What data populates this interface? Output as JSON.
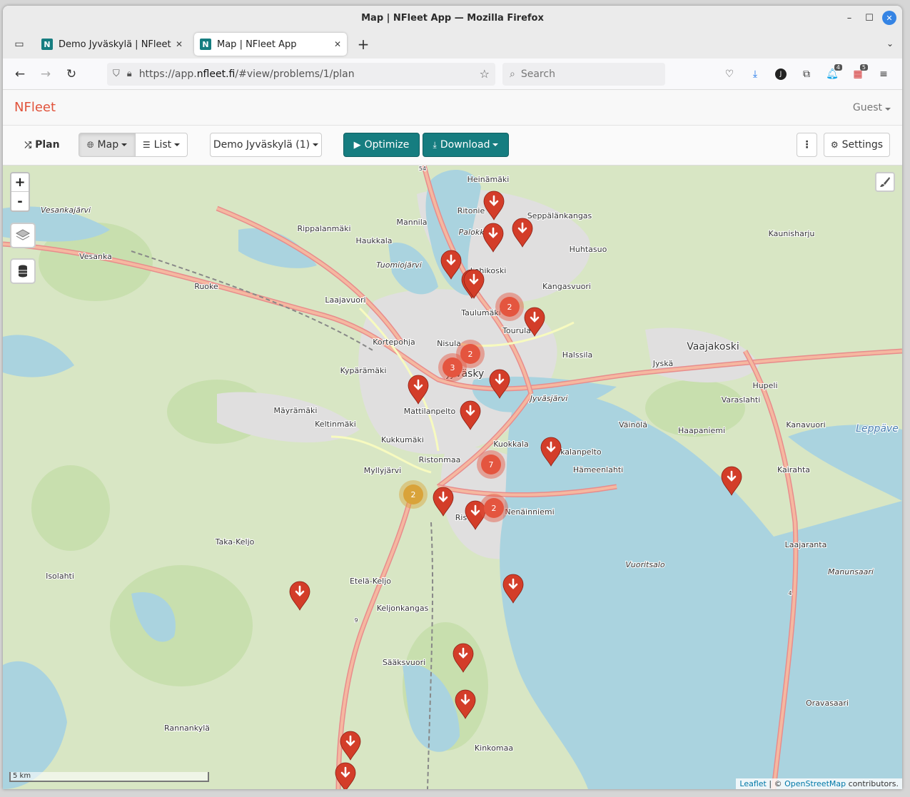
{
  "window": {
    "title": "Map | NFleet App — Mozilla Firefox"
  },
  "tabs": [
    {
      "favicon": "N",
      "label": "Demo Jyväskylä | NFleet Co",
      "close": "✕"
    },
    {
      "favicon": "N",
      "label": "Map | NFleet App",
      "close": "✕"
    }
  ],
  "nav": {
    "url_prefix": "https://app.",
    "url_domain": "nfleet.fi",
    "url_suffix": "/#view/problems/1/plan",
    "search_placeholder": "Search",
    "extension_badges": [
      "4",
      "5"
    ],
    "profile_initial": "J"
  },
  "app": {
    "brand": "NFleet",
    "user_menu": "Guest"
  },
  "toolbar": {
    "plan_label": "Plan",
    "map_label": "Map",
    "list_label": "List",
    "problem_select": "Demo Jyväskylä (1)",
    "optimize_label": "Optimize",
    "download_label": "Download",
    "more_label": "⋮",
    "settings_label": "Settings",
    "accent_color": "#167d80"
  },
  "map": {
    "zoom_in": "+",
    "zoom_out": "-",
    "scale_label": "5 km",
    "attribution_leaflet": "Leaflet",
    "attribution_sep": " | © ",
    "attribution_osm": "OpenStreetMap",
    "attribution_tail": " contributors.",
    "marker_color": "#d33d29",
    "place_labels": [
      "Heinämäki",
      "Ritonie",
      "Seppälänkangas",
      "Mannila",
      "Rippalanmäki",
      "Haukkala",
      "Huhtasuo",
      "Vesanka",
      "Kaunisharju",
      "Lohikoski",
      "Ruoke",
      "Kangasvuori",
      "Laajavuori",
      "Taulumäki",
      "Tourula",
      "Kortepohja",
      "Nisula",
      "Halssila",
      "Jyskä",
      "Vaajakoski",
      "Kypärämäki",
      "Jyväsky",
      "Hupeli",
      "Varaslahti",
      "Mattilanpelto",
      "Jyväsjärvi",
      "Mäyrämäki",
      "Keltinmäki",
      "Väinölä",
      "Haapaniemi",
      "Kanavuori",
      "Kukkumäki",
      "Kuokkala",
      "Kekkalanpelto",
      "Ristonmaa",
      "Hämeenlahti",
      "Myllyjärvi",
      "Kairahta",
      "Nenäinniemi",
      "Ris",
      "Taka-Keljo",
      "Vuoritsalo",
      "Laajaranta",
      "Isolahti",
      "Manunsaari",
      "Etelä-Keljo",
      "Keljonkangas",
      "Sääksvuori",
      "Oravasaari",
      "Rannankylä",
      "Kinkomaa",
      "Leppäve",
      "Vesankajärvi",
      "Palokka",
      "Tuomiojärvi",
      "Laajavuori",
      "54",
      "9",
      "4"
    ],
    "cluster_counts": [
      "2",
      "2",
      "3",
      "7",
      "2",
      "2"
    ],
    "single_markers": 20
  }
}
